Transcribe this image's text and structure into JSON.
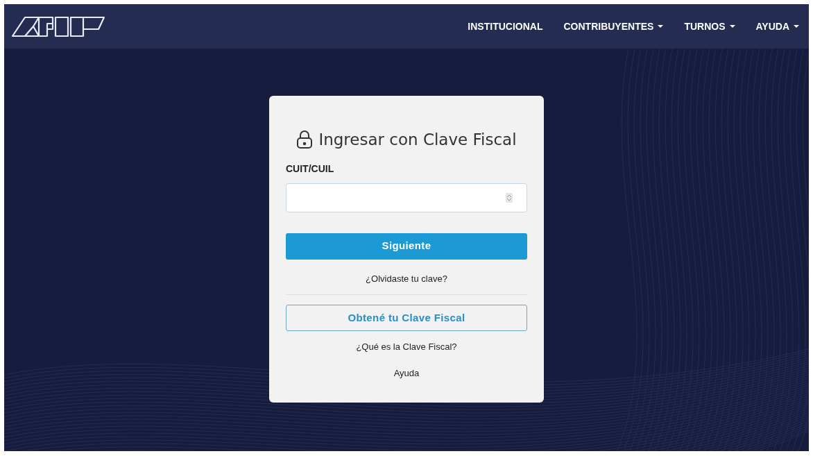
{
  "nav": {
    "items": [
      {
        "label": "INSTITUCIONAL",
        "has_menu": false
      },
      {
        "label": "CONTRIBUYENTES",
        "has_menu": true
      },
      {
        "label": "TURNOS",
        "has_menu": true
      },
      {
        "label": "AYUDA",
        "has_menu": true
      }
    ]
  },
  "login": {
    "title": "Ingresar con Clave Fiscal",
    "field_label": "CUIT/CUIL",
    "submit": "Siguiente",
    "forgot_link": "¿Olvidaste tu clave?",
    "get_key_button": "Obtené tu Clave Fiscal",
    "links": [
      "¿Qué es la Clave Fiscal?",
      "Ayuda"
    ]
  }
}
